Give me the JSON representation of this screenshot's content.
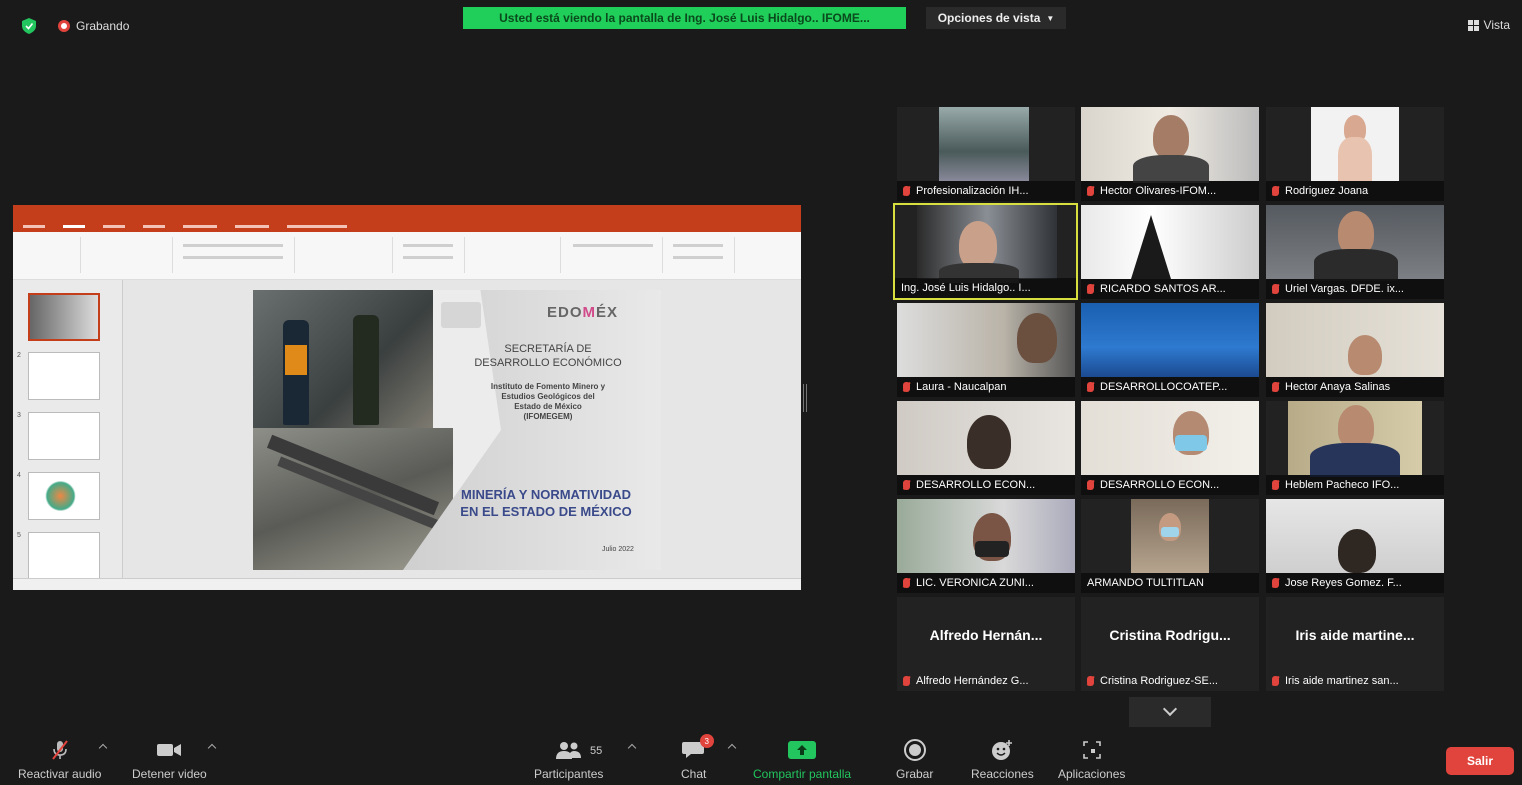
{
  "topbar": {
    "recording_label": "Grabando",
    "share_banner": "Usted está viendo la pantalla de Ing. José Luis Hidalgo.. IFOME...",
    "view_options": "Opciones de vista",
    "view_label": "Vista"
  },
  "slide": {
    "brand_prefix": "EDO",
    "brand_accent": "M",
    "brand_suffix": "ÉX",
    "secretaria_line1": "SECRETARÍA DE",
    "secretaria_line2": "DESARROLLO ECONÓMICO",
    "institute_line1": "Instituto de Fomento Minero y",
    "institute_line2": "Estudios Geológicos del",
    "institute_line3": "Estado de México",
    "institute_line4": "(IFOMEGEM)",
    "main_title_line1": "MINERÍA Y NORMATIVIDAD",
    "main_title_line2": "EN EL ESTADO DE MÉXICO",
    "date": "Julio 2022"
  },
  "participants": [
    {
      "name": "Profesionalización IH..."
    },
    {
      "name": "Hector Olivares-IFOM..."
    },
    {
      "name": "Rodriguez Joana"
    },
    {
      "name": "Ing. José Luis Hidalgo.. I..."
    },
    {
      "name": "RICARDO SANTOS AR..."
    },
    {
      "name": "Uriel Vargas. DFDE. ix..."
    },
    {
      "name": "Laura - Naucalpan"
    },
    {
      "name": "DESARROLLOCOATEP..."
    },
    {
      "name": "Hector Anaya Salinas"
    },
    {
      "name": "DESARROLLO ECON..."
    },
    {
      "name": "DESARROLLO ECON..."
    },
    {
      "name": "Heblem Pacheco IFO..."
    },
    {
      "name": "LIC. VERONICA ZUNI..."
    },
    {
      "name": "ARMANDO TULTITLAN"
    },
    {
      "name": "Jose Reyes Gomez. F..."
    },
    {
      "name": "Alfredo Hernández G...",
      "display": "Alfredo Hernán..."
    },
    {
      "name": "Cristina Rodriguez-SE...",
      "display": "Cristina Rodrigu..."
    },
    {
      "name": "Iris aide martinez san...",
      "display": "Iris aide martine..."
    }
  ],
  "toolbar": {
    "unmute": "Reactivar audio",
    "stop_video": "Detener video",
    "participants": "Participantes",
    "participants_count": "55",
    "chat": "Chat",
    "chat_badge": "3",
    "share": "Compartir pantalla",
    "record": "Grabar",
    "reactions": "Reacciones",
    "apps": "Aplicaciones",
    "leave": "Salir"
  },
  "colors": {
    "accent_green": "#22c55e",
    "leave_red": "#e0443c",
    "speaker_border": "#d8e040",
    "ppt_red": "#c43e1c"
  }
}
